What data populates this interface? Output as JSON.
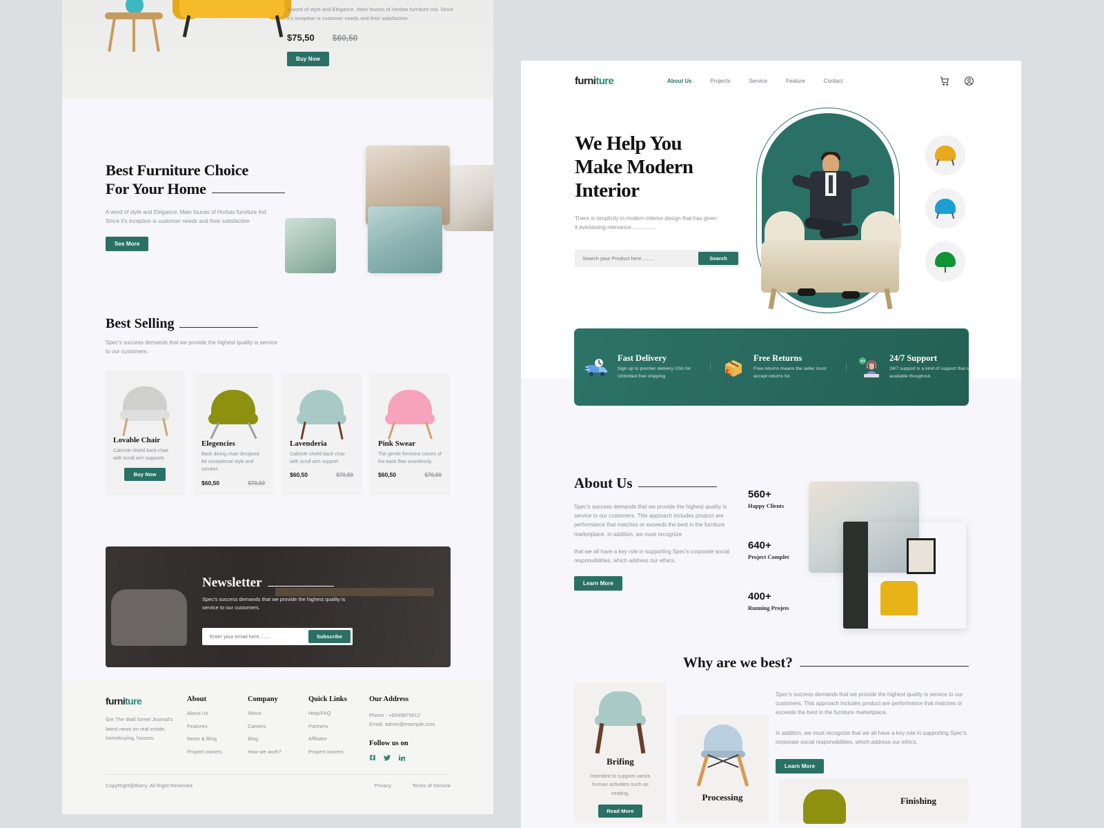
{
  "brand": {
    "part1": "furni",
    "part2": "ture"
  },
  "left_page": {
    "top_product": {
      "desc": "A word of style and Elegance. Main fouces of Horbax furniture Ind. Since it's inception is customer needs and their satisfaction",
      "price_now": "$75,50",
      "price_old": "$60,50",
      "buy_label": "Buy Now"
    },
    "best_choice": {
      "title_line1": "Best Furniture Choice",
      "title_line2": "For Your Home",
      "desc": "A word of style and Elegance. Main fouces of Horbax furniture Ind. Since it's inception is customer needs and their satisfaction",
      "button": "See More"
    },
    "best_selling": {
      "title": "Best Selling",
      "desc": "Spec's success demands that we provide the highest quality is service to our customers.",
      "products": [
        {
          "name": "Lovable Chair",
          "desc": "Cabriole shield back chair with scroll arm supports",
          "price_now": "",
          "price_old": "",
          "button": "Buy Now",
          "color": "#cfcfcd",
          "leg": "#c8a876"
        },
        {
          "name": "Elegencies",
          "desc": "Back dining chair designed for exceptional style and comfort",
          "price_now": "$60,50",
          "price_old": "$70,50",
          "button": "",
          "color": "#8e9110",
          "leg": "#9aa0a5"
        },
        {
          "name": "Lavenderia",
          "desc": "Cabriole shield back chair with scroll arm support",
          "price_now": "$60,50",
          "price_old": "$70,50",
          "button": "",
          "color": "#a9c9c6",
          "leg": "#6b3d2a"
        },
        {
          "name": "Pink Swear",
          "desc": "The gentle feminine curves of the back flow seamlessly",
          "price_now": "$60,50",
          "price_old": "$70,50",
          "button": "",
          "color": "#f7a3bd",
          "leg": "#d2a06d"
        }
      ]
    },
    "newsletter": {
      "title": "Newsletter",
      "desc": "Spec's success demands that we provide the highest quality is service to our customers.",
      "placeholder": "Enter your email here........",
      "button": "Subscribe"
    },
    "footer": {
      "tagline": "Get The Wall Street Journal's latest news on real estate, homebuying, houses.",
      "columns": [
        {
          "heading": "About",
          "items": [
            "About Us",
            "Features",
            "News & Blog",
            "Propert owners"
          ]
        },
        {
          "heading": "Company",
          "items": [
            "About",
            "Careers",
            "Blog",
            "How we work?"
          ]
        },
        {
          "heading": "Quick Links",
          "items": [
            "Help/FAQ",
            "Partners",
            "Affliates",
            "Propert owners"
          ]
        }
      ],
      "address": {
        "heading": "Our Address",
        "phone": "Phone : +6549879912",
        "email": "Email: admin@example.com",
        "follow_heading": "Follow us on",
        "socials": [
          "facebook-icon",
          "twitter-icon",
          "linkedin-icon"
        ]
      },
      "copyright": "CopyRight@Barry. All Right Reserved",
      "privacy": "Privacy",
      "terms": "Terms of Service"
    }
  },
  "right_page": {
    "nav": {
      "links": [
        {
          "label": "About Us",
          "active": true
        },
        {
          "label": "Projects",
          "active": false
        },
        {
          "label": "Service",
          "active": false
        },
        {
          "label": "Feature",
          "active": false
        },
        {
          "label": "Contact",
          "active": false
        }
      ],
      "cart_icon": "cart-icon",
      "account_icon": "account-icon"
    },
    "hero": {
      "title_line1": "We Help You",
      "title_line2": "Make Modern",
      "title_line3": "Interior",
      "desc": "There is simplicity in modern interior design that has given it everlasting relevance................",
      "search_placeholder": "Search your Product here.........",
      "search_button": "Search",
      "float_chairs": [
        "#e8a91c",
        "#1d9fd4",
        "#0f9436"
      ]
    },
    "features": [
      {
        "icon": "delivery-truck-icon",
        "title": "Fast Delivery",
        "desc": "Sign up to premier delivery USA for Unlimited free shipping"
      },
      {
        "icon": "return-box-icon",
        "title": "Free Returns",
        "desc": "Free returns means the seller must accept returns for."
      },
      {
        "icon": "support-agent-icon",
        "title": "24/7 Support",
        "desc": "24/7 support is a kind of support that is available thoughout."
      }
    ],
    "about": {
      "title": "About Us",
      "para1": "Spec's success demands that we provide the highest quality is service to our customers. This approach includes product are performance that matches or exceeds the best in the furniture marketplace. In addition, we must recognize",
      "para2": "that we all have a key role in supporting Spec's corporate social responsibilities, which address our ethics,",
      "button": "Learn More",
      "stats": [
        {
          "number": "560+",
          "label": "Happy Clients"
        },
        {
          "number": "640+",
          "label": "Project Complet"
        },
        {
          "number": "400+",
          "label": "Running Projets"
        }
      ]
    },
    "why": {
      "title": "Why are we best?",
      "para1": "Spec's success demands that we provide the highest quality is service to our customers. This approach includes product are performance that matches or exceeds the best in the furniture marketplace.",
      "para2": "In addition, we must recognize that we all have a key role in supporting Spec's corporate social responsibilities, which address our ethics,",
      "button": "Learn More",
      "cards": [
        {
          "title": "Brifing",
          "desc": "Intended to support varois human activities such as seating.",
          "button": "Read More"
        },
        {
          "title": "Processing",
          "desc": "",
          "button": ""
        },
        {
          "title": "Finishing",
          "desc": "",
          "button": ""
        }
      ]
    }
  },
  "colors": {
    "teal": "#2a7065",
    "teal_dark": "#236053",
    "page_bg": "#f7f7fb",
    "canvas": "#dcdfe2"
  }
}
